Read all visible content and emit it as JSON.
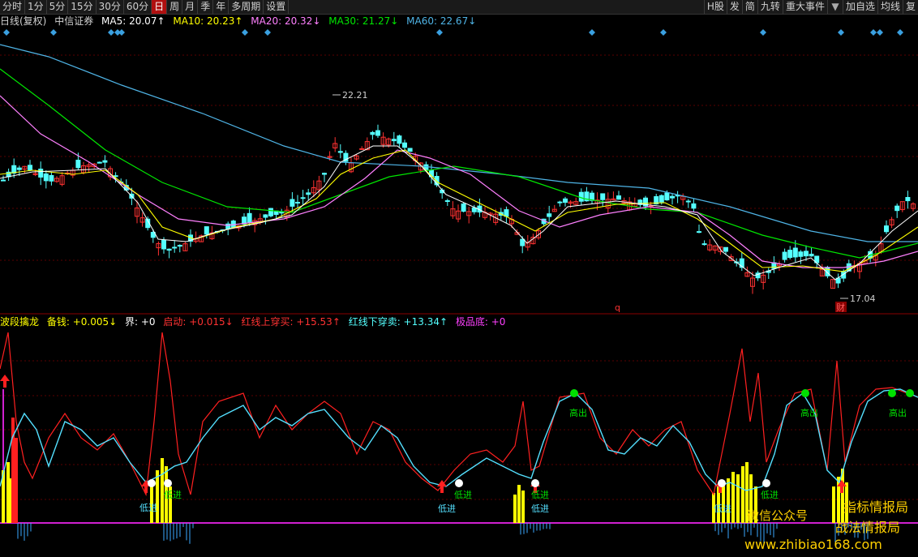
{
  "toolbar": {
    "left": [
      "分时",
      "1分",
      "5分",
      "15分",
      "30分",
      "60分",
      "日",
      "周",
      "月",
      "季",
      "年",
      "多周期",
      "设置"
    ],
    "active": "日",
    "right": [
      "H股",
      "发",
      "简",
      "九转",
      "重大事件",
      "▼",
      "加自选",
      "均线",
      "复"
    ]
  },
  "main_info": {
    "period": "日线(复权)",
    "name": "中信证券",
    "ma5": "MA5: 20.07↑",
    "ma10": "MA10: 20.23↑",
    "ma20": "MA20: 20.32↓",
    "ma30": "MA30: 21.27↓",
    "ma60": "MA60: 22.67↓"
  },
  "colors": {
    "up": "#ff3232",
    "down": "#54ffff",
    "ma5": "#ffffff",
    "ma10": "#ffff00",
    "ma20": "#ff80ff",
    "ma30": "#00e600",
    "ma60": "#4fb4e6",
    "magenta_line": "#d020d0"
  },
  "price_labels": {
    "high": "22.21",
    "low": "17.04",
    "marker_q": "q",
    "marker_cai": "财"
  },
  "indicator_info": {
    "name": "波段擒龙",
    "beiqian": "备钱: +0.005↓",
    "jie": "界: +0",
    "qidong": "启动: +0.015↓",
    "red_up": "红线上穿买: +15.53↑",
    "red_down": "红线下穿卖: +13.34↑",
    "jipin": "极品底: +0"
  },
  "signals": {
    "low_in": "低进",
    "high_out": "高出"
  },
  "watermark": {
    "line1": "指标情报局",
    "line2": "战法情报局",
    "wechat": "微信公众号",
    "site": "www.zhibiao168.com"
  }
}
